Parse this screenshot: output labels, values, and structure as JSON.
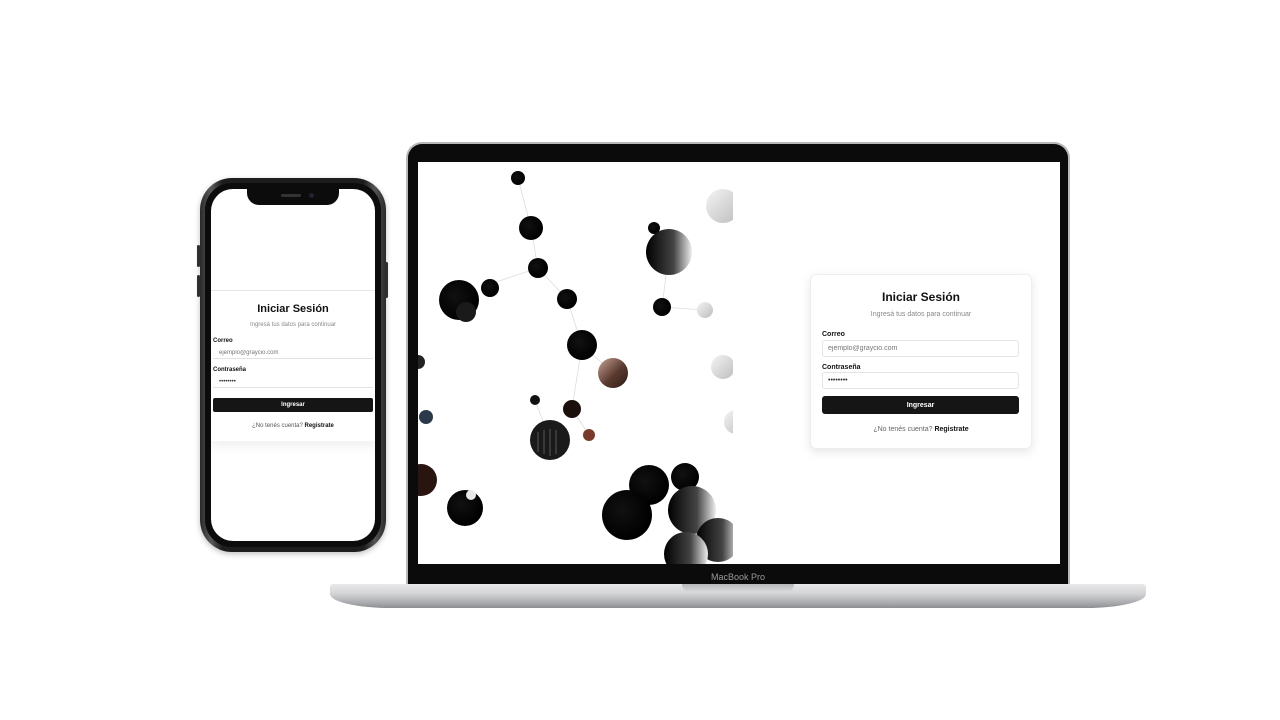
{
  "login": {
    "title": "Iniciar Sesión",
    "subtitle": "Ingresá tus datos para continuar",
    "email_label": "Correo",
    "email_placeholder": "ejemplo@graycio.com",
    "password_label": "Contraseña",
    "password_value": "••••••••",
    "submit_label": "Ingresar",
    "register_prompt": "¿No tenés cuenta?",
    "register_link": "Registrate"
  },
  "laptop": {
    "model_label": "MacBook Pro"
  },
  "colors": {
    "button_bg": "#151515",
    "button_text": "#ffffff",
    "device_frame": "#0b0b0b",
    "laptop_base": "#d3d4d6"
  }
}
